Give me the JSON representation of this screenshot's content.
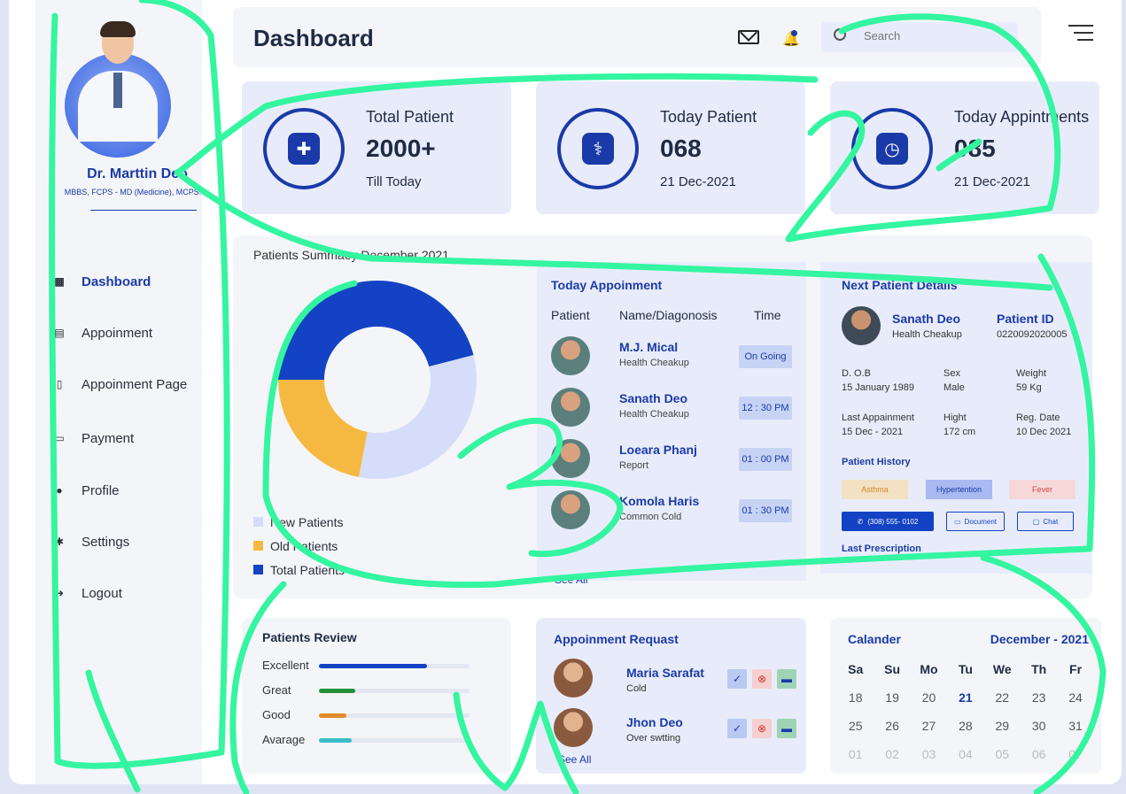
{
  "header": {
    "title": "Dashboard",
    "search_placeholder": "Search"
  },
  "doctor": {
    "name": "Dr. Marttin Deo",
    "degrees": "MBBS, FCPS - MD (Medicine), MCPS."
  },
  "sidebar": {
    "items": [
      {
        "label": "Dashboard",
        "icon": "grid-icon",
        "active": true
      },
      {
        "label": "Appoinment",
        "icon": "calendar-icon",
        "active": false
      },
      {
        "label": "Appoinment Page",
        "icon": "document-icon",
        "active": false
      },
      {
        "label": "Payment",
        "icon": "card-icon",
        "active": false
      },
      {
        "label": "Profile",
        "icon": "user-icon",
        "active": false
      },
      {
        "label": "Settings",
        "icon": "gear-icon",
        "active": false
      },
      {
        "label": "Logout",
        "icon": "logout-icon",
        "active": false
      }
    ]
  },
  "stats": [
    {
      "title": "Total Patient",
      "value": "2000+",
      "sub": "Till Today",
      "icon": "patient-icon"
    },
    {
      "title": "Today Patient",
      "value": "068",
      "sub": "21 Dec-2021",
      "icon": "patient-drip-icon"
    },
    {
      "title": "Today Appintments",
      "value": "085",
      "sub": "21 Dec-2021",
      "icon": "clock-icon"
    }
  ],
  "summary": {
    "title": "Patients Summaey December 2021",
    "legend": [
      {
        "label": "New Patients",
        "color": "#d5ddfa"
      },
      {
        "label": "Old Patients",
        "color": "#f5b942"
      },
      {
        "label": "Total Patients",
        "color": "#1342c4"
      }
    ],
    "shares": [
      0.32,
      0.22,
      0.46
    ]
  },
  "appointments": {
    "title": "Today Appoinment",
    "headers": [
      "Patient",
      "Name/Diagonosis",
      "Time"
    ],
    "rows": [
      {
        "name": "M.J. Mical",
        "diag": "Health Cheakup",
        "time": "On Going"
      },
      {
        "name": "Sanath Deo",
        "diag": "Health Cheakup",
        "time": "12 : 30 PM"
      },
      {
        "name": "Loeara Phanj",
        "diag": "Report",
        "time": "01 : 00 PM"
      },
      {
        "name": "Komola Haris",
        "diag": "Common Cold",
        "time": "01 : 30 PM"
      }
    ],
    "see_all": "See All"
  },
  "next_patient": {
    "title": "Next Patient Details",
    "name": "Sanath Deo",
    "diag": "Health Cheakup",
    "pid_label": "Patient ID",
    "pid": "0220092020005",
    "fields": [
      {
        "label": "D. O.B",
        "value": "15 January 1989"
      },
      {
        "label": "Sex",
        "value": "Male"
      },
      {
        "label": "Weight",
        "value": "59 Kg"
      },
      {
        "label": "Last Appainment",
        "value": "15 Dec - 2021"
      },
      {
        "label": "Hight",
        "value": "172 cm"
      },
      {
        "label": "Reg. Date",
        "value": "10 Dec 2021"
      }
    ],
    "history_title": "Patient History",
    "tags": [
      {
        "label": "Asthma",
        "bg": "#f3e1c4",
        "fg": "#d08a21"
      },
      {
        "label": "Hypertention",
        "bg": "#a9b9f1",
        "fg": "#1a3aa8"
      },
      {
        "label": "Fever",
        "bg": "#f6d8d8",
        "fg": "#d04545"
      }
    ],
    "phone": "(308) 555- 0102",
    "document": "Document",
    "chat": "Chat",
    "last_label": "Last Prescription"
  },
  "review": {
    "title": "Patients Review",
    "rows": [
      {
        "label": "Excellent",
        "value": 0.72,
        "color": "#1342c4"
      },
      {
        "label": "Great",
        "value": 0.24,
        "color": "#23913b"
      },
      {
        "label": "Good",
        "value": 0.18,
        "color": "#e38a29"
      },
      {
        "label": "Avarage",
        "value": 0.22,
        "color": "#3bbcc9"
      }
    ]
  },
  "requests": {
    "title": "Appoinment Requast",
    "rows": [
      {
        "name": "Maria Sarafat",
        "diag": "Cold"
      },
      {
        "name": "Jhon Deo",
        "diag": "Over swtting"
      }
    ],
    "see_all": "See All"
  },
  "calendar": {
    "title": "Calander",
    "month": "December - 2021",
    "days": [
      "Sa",
      "Su",
      "Mo",
      "Tu",
      "We",
      "Th",
      "Fr"
    ],
    "weeks": [
      [
        "18",
        "19",
        "20",
        "21",
        "22",
        "23",
        "24"
      ],
      [
        "25",
        "26",
        "27",
        "28",
        "29",
        "30",
        "31"
      ],
      [
        "01",
        "02",
        "03",
        "04",
        "05",
        "06",
        "07"
      ]
    ],
    "today": "21"
  }
}
